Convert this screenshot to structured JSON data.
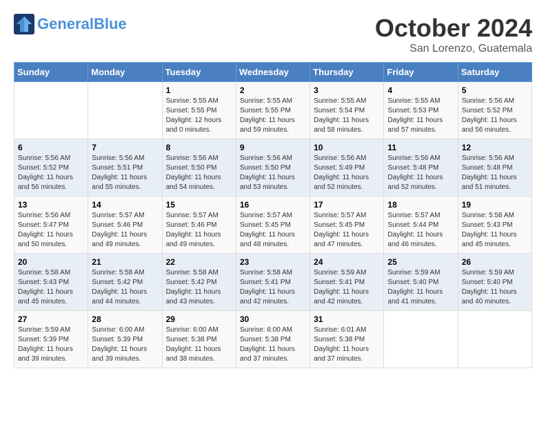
{
  "header": {
    "logo_general": "General",
    "logo_blue": "Blue",
    "title": "October 2024",
    "subtitle": "San Lorenzo, Guatemala"
  },
  "days_of_week": [
    "Sunday",
    "Monday",
    "Tuesday",
    "Wednesday",
    "Thursday",
    "Friday",
    "Saturday"
  ],
  "weeks": [
    [
      {
        "day": "",
        "info": ""
      },
      {
        "day": "",
        "info": ""
      },
      {
        "day": "1",
        "info": "Sunrise: 5:55 AM\nSunset: 5:55 PM\nDaylight: 12 hours and 0 minutes."
      },
      {
        "day": "2",
        "info": "Sunrise: 5:55 AM\nSunset: 5:55 PM\nDaylight: 11 hours and 59 minutes."
      },
      {
        "day": "3",
        "info": "Sunrise: 5:55 AM\nSunset: 5:54 PM\nDaylight: 11 hours and 58 minutes."
      },
      {
        "day": "4",
        "info": "Sunrise: 5:55 AM\nSunset: 5:53 PM\nDaylight: 11 hours and 57 minutes."
      },
      {
        "day": "5",
        "info": "Sunrise: 5:56 AM\nSunset: 5:52 PM\nDaylight: 11 hours and 56 minutes."
      }
    ],
    [
      {
        "day": "6",
        "info": "Sunrise: 5:56 AM\nSunset: 5:52 PM\nDaylight: 11 hours and 56 minutes."
      },
      {
        "day": "7",
        "info": "Sunrise: 5:56 AM\nSunset: 5:51 PM\nDaylight: 11 hours and 55 minutes."
      },
      {
        "day": "8",
        "info": "Sunrise: 5:56 AM\nSunset: 5:50 PM\nDaylight: 11 hours and 54 minutes."
      },
      {
        "day": "9",
        "info": "Sunrise: 5:56 AM\nSunset: 5:50 PM\nDaylight: 11 hours and 53 minutes."
      },
      {
        "day": "10",
        "info": "Sunrise: 5:56 AM\nSunset: 5:49 PM\nDaylight: 11 hours and 52 minutes."
      },
      {
        "day": "11",
        "info": "Sunrise: 5:56 AM\nSunset: 5:48 PM\nDaylight: 11 hours and 52 minutes."
      },
      {
        "day": "12",
        "info": "Sunrise: 5:56 AM\nSunset: 5:48 PM\nDaylight: 11 hours and 51 minutes."
      }
    ],
    [
      {
        "day": "13",
        "info": "Sunrise: 5:56 AM\nSunset: 5:47 PM\nDaylight: 11 hours and 50 minutes."
      },
      {
        "day": "14",
        "info": "Sunrise: 5:57 AM\nSunset: 5:46 PM\nDaylight: 11 hours and 49 minutes."
      },
      {
        "day": "15",
        "info": "Sunrise: 5:57 AM\nSunset: 5:46 PM\nDaylight: 11 hours and 49 minutes."
      },
      {
        "day": "16",
        "info": "Sunrise: 5:57 AM\nSunset: 5:45 PM\nDaylight: 11 hours and 48 minutes."
      },
      {
        "day": "17",
        "info": "Sunrise: 5:57 AM\nSunset: 5:45 PM\nDaylight: 11 hours and 47 minutes."
      },
      {
        "day": "18",
        "info": "Sunrise: 5:57 AM\nSunset: 5:44 PM\nDaylight: 11 hours and 46 minutes."
      },
      {
        "day": "19",
        "info": "Sunrise: 5:58 AM\nSunset: 5:43 PM\nDaylight: 11 hours and 45 minutes."
      }
    ],
    [
      {
        "day": "20",
        "info": "Sunrise: 5:58 AM\nSunset: 5:43 PM\nDaylight: 11 hours and 45 minutes."
      },
      {
        "day": "21",
        "info": "Sunrise: 5:58 AM\nSunset: 5:42 PM\nDaylight: 11 hours and 44 minutes."
      },
      {
        "day": "22",
        "info": "Sunrise: 5:58 AM\nSunset: 5:42 PM\nDaylight: 11 hours and 43 minutes."
      },
      {
        "day": "23",
        "info": "Sunrise: 5:58 AM\nSunset: 5:41 PM\nDaylight: 11 hours and 42 minutes."
      },
      {
        "day": "24",
        "info": "Sunrise: 5:59 AM\nSunset: 5:41 PM\nDaylight: 11 hours and 42 minutes."
      },
      {
        "day": "25",
        "info": "Sunrise: 5:59 AM\nSunset: 5:40 PM\nDaylight: 11 hours and 41 minutes."
      },
      {
        "day": "26",
        "info": "Sunrise: 5:59 AM\nSunset: 5:40 PM\nDaylight: 11 hours and 40 minutes."
      }
    ],
    [
      {
        "day": "27",
        "info": "Sunrise: 5:59 AM\nSunset: 5:39 PM\nDaylight: 11 hours and 39 minutes."
      },
      {
        "day": "28",
        "info": "Sunrise: 6:00 AM\nSunset: 5:39 PM\nDaylight: 11 hours and 39 minutes."
      },
      {
        "day": "29",
        "info": "Sunrise: 6:00 AM\nSunset: 5:38 PM\nDaylight: 11 hours and 38 minutes."
      },
      {
        "day": "30",
        "info": "Sunrise: 6:00 AM\nSunset: 5:38 PM\nDaylight: 11 hours and 37 minutes."
      },
      {
        "day": "31",
        "info": "Sunrise: 6:01 AM\nSunset: 5:38 PM\nDaylight: 11 hours and 37 minutes."
      },
      {
        "day": "",
        "info": ""
      },
      {
        "day": "",
        "info": ""
      }
    ]
  ]
}
